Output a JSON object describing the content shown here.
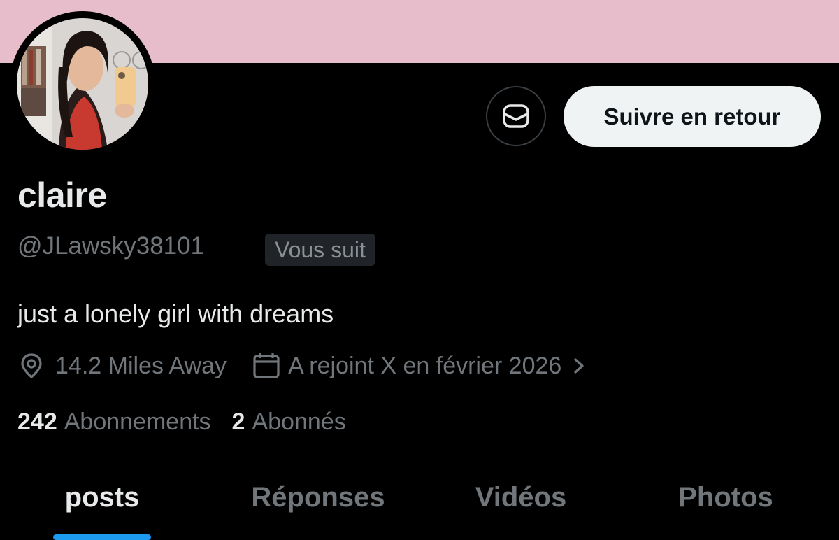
{
  "profile": {
    "display_name": "claire",
    "handle": "@JLawsky38101",
    "follows_you_badge": "Vous suit",
    "bio": "just a lonely girl with dreams",
    "location": "14.2 Miles Away",
    "joined": "A rejoint X en février 2026",
    "following_count": "242",
    "following_label": "Abonnements",
    "followers_count": "2",
    "followers_label": "Abonnés",
    "banner_color": "#e7bccb"
  },
  "actions": {
    "message_icon": "envelope-icon",
    "follow_back_label": "Suivre en retour"
  },
  "icons": {
    "location": "map-pin-icon",
    "joined": "calendar-icon",
    "joined_more": "chevron-right-icon"
  },
  "tabs": [
    {
      "label": "posts",
      "active": true
    },
    {
      "label": "Réponses",
      "active": false
    },
    {
      "label": "Vidéos",
      "active": false
    },
    {
      "label": "Photos",
      "active": false
    }
  ],
  "colors": {
    "accent": "#1d9bf0",
    "background": "#000000",
    "text_primary": "#e7e9ea",
    "text_secondary": "#71767b"
  }
}
